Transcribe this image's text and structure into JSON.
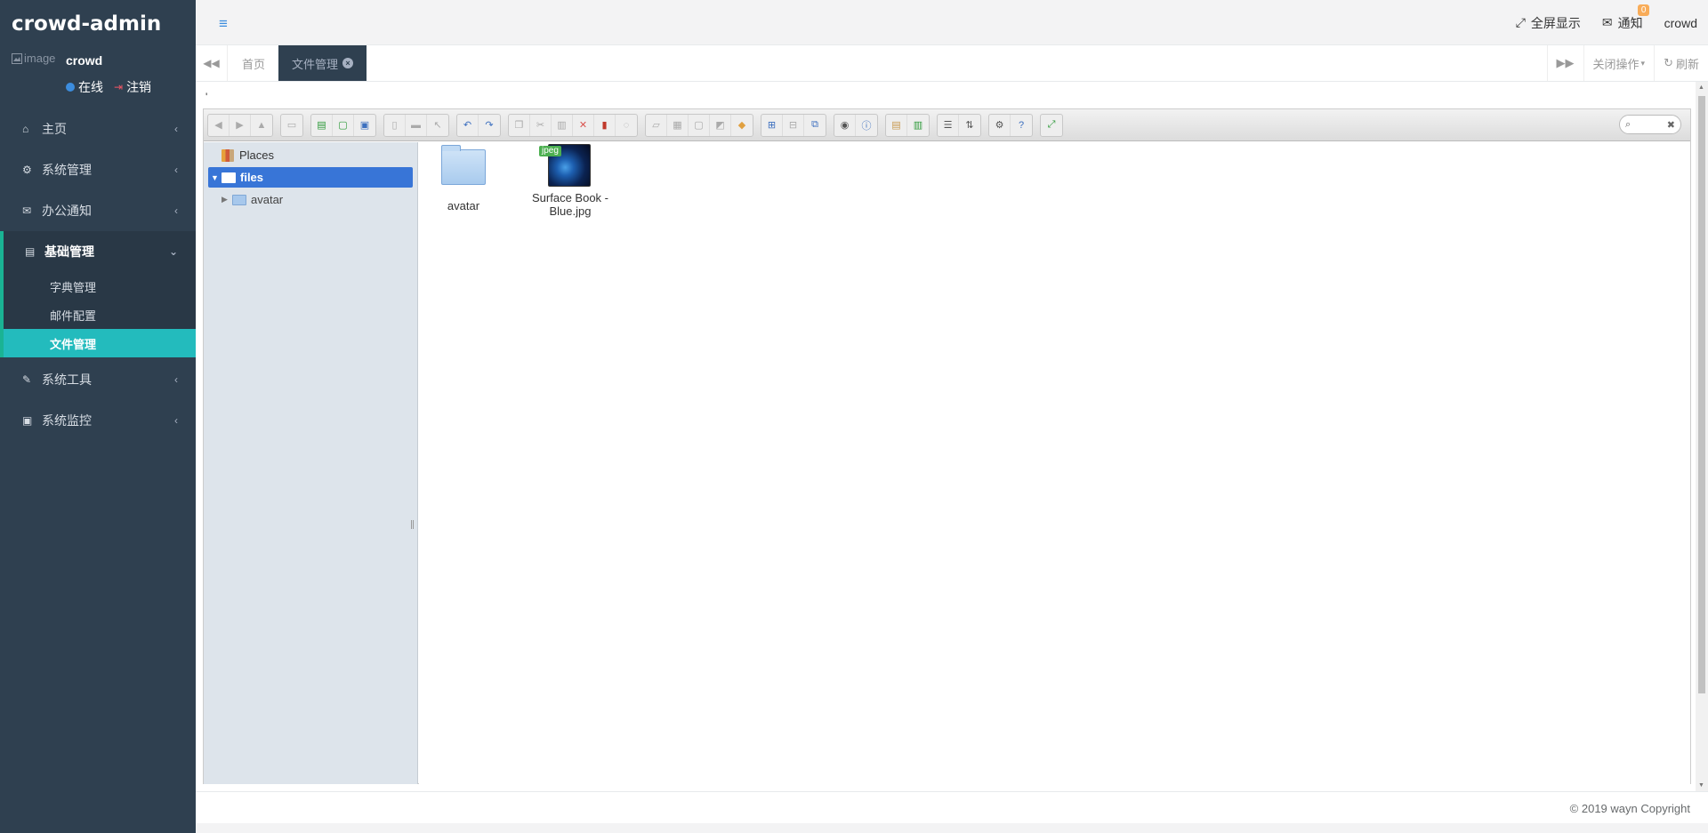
{
  "brand": "crowd-admin",
  "user": {
    "avatar_alt": "image",
    "name": "crowd",
    "status": "在线",
    "logout": "注销"
  },
  "menu": [
    {
      "label": "主页",
      "icon": "home-icon"
    },
    {
      "label": "系统管理",
      "icon": "gear-icon"
    },
    {
      "label": "办公通知",
      "icon": "envelope-icon"
    },
    {
      "label": "基础管理",
      "icon": "id-card-icon",
      "active": true
    },
    {
      "label": "系统工具",
      "icon": "wrench-icon"
    },
    {
      "label": "系统监控",
      "icon": "monitor-icon"
    }
  ],
  "submenu": [
    {
      "label": "字典管理"
    },
    {
      "label": "邮件配置"
    },
    {
      "label": "文件管理",
      "current": true
    }
  ],
  "topbar": {
    "fullscreen": "全屏显示",
    "notify": "通知",
    "notify_count": "0",
    "user": "crowd"
  },
  "tabs": {
    "home": "首页",
    "active": "文件管理",
    "close_ops": "关闭操作",
    "refresh": "刷新"
  },
  "content": {
    "cursor_char": "'"
  },
  "filemanager": {
    "places": "Places",
    "root": "files",
    "tree_child": "avatar",
    "items": [
      {
        "name": "avatar",
        "kind": "folder"
      },
      {
        "name": "Surface Book - Blue.jpg",
        "kind": "jpeg",
        "tag": "jpeg"
      }
    ],
    "search_placeholder": ""
  },
  "footer": {
    "copyright": "© 2019 wayn Copyright"
  },
  "colors": {
    "sidebar_bg": "#2f4050",
    "accent_teal": "#23bbbd",
    "active_border": "#1ab394",
    "tree_selected": "#3875d7",
    "badge": "#f8ac59"
  }
}
